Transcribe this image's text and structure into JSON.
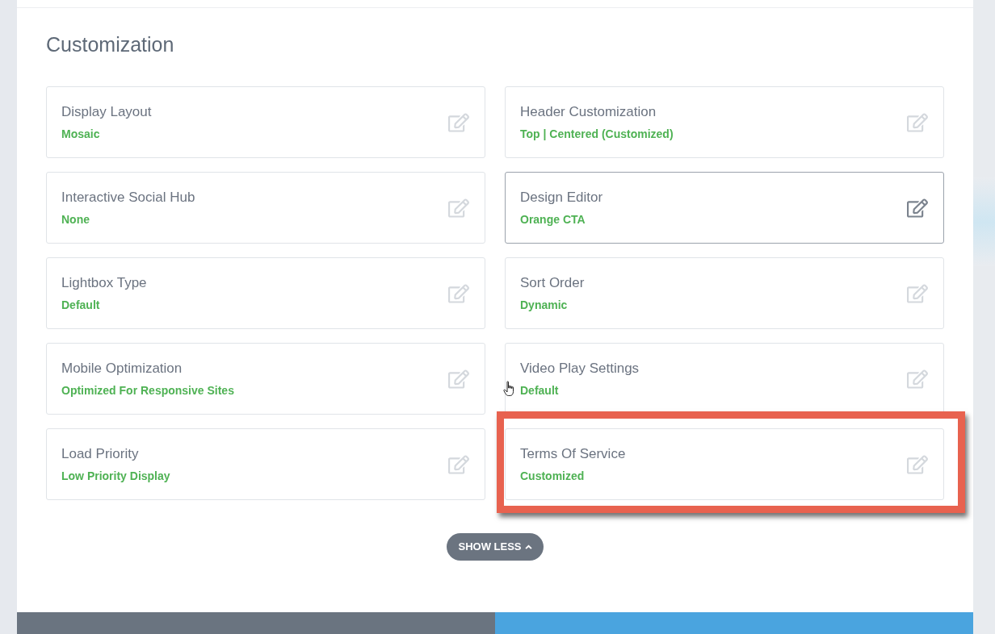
{
  "section": {
    "title": "Customization"
  },
  "cards": [
    {
      "label": "Display Layout",
      "value": "Mosaic",
      "highlighted": false,
      "callout": false,
      "cursor": false
    },
    {
      "label": "Header Customization",
      "value": "Top | Centered (Customized)",
      "highlighted": false,
      "callout": false,
      "cursor": false
    },
    {
      "label": "Interactive Social Hub",
      "value": "None",
      "highlighted": false,
      "callout": false,
      "cursor": false
    },
    {
      "label": "Design Editor",
      "value": "Orange CTA",
      "highlighted": true,
      "callout": false,
      "cursor": false
    },
    {
      "label": "Lightbox Type",
      "value": "Default",
      "highlighted": false,
      "callout": false,
      "cursor": false
    },
    {
      "label": "Sort Order",
      "value": "Dynamic",
      "highlighted": false,
      "callout": false,
      "cursor": false
    },
    {
      "label": "Mobile Optimization",
      "value": "Optimized For Responsive Sites",
      "highlighted": false,
      "callout": false,
      "cursor": false
    },
    {
      "label": "Video Play Settings",
      "value": "Default",
      "highlighted": false,
      "callout": false,
      "cursor": true
    },
    {
      "label": "Load Priority",
      "value": "Low Priority Display",
      "highlighted": false,
      "callout": false,
      "cursor": false
    },
    {
      "label": "Terms Of Service",
      "value": "Customized",
      "highlighted": false,
      "callout": true,
      "cursor": false
    }
  ],
  "show_less_button": {
    "label": "SHOW LESS"
  }
}
